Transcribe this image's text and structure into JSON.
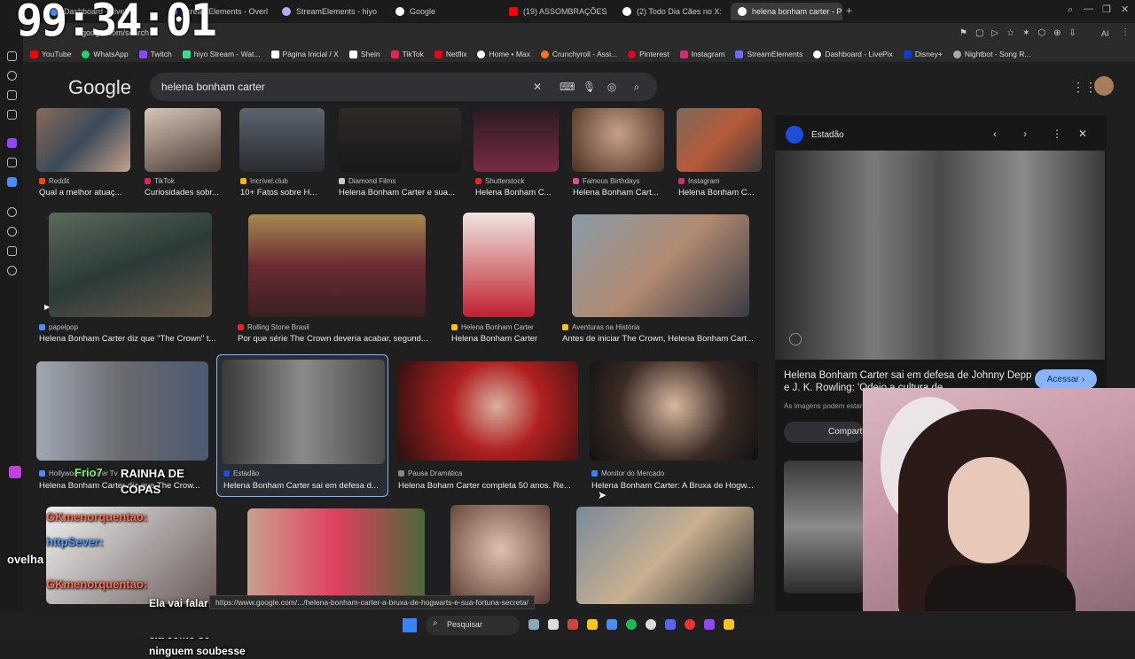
{
  "clock": "99:34:01",
  "tabs": [
    {
      "label": "Dashboard - LivePix",
      "color": "#4a8df8"
    },
    {
      "label": "StreamElements - Overlay",
      "color": "#6b6bff"
    },
    {
      "label": "StreamElements - hiyo",
      "color": "#b9a7ff"
    },
    {
      "label": "Google",
      "color": "#ffffff"
    },
    {
      "label": "(19) ASSOMBRAÇÕES INE",
      "color": "#ff0000"
    },
    {
      "label": "(2) Todo Dia Cães no X: \"",
      "color": "#ffffff"
    },
    {
      "label": "helena bonham carter - P",
      "color": "#ffffff"
    }
  ],
  "address": "google.com/search",
  "bookmarks": [
    {
      "label": "YouTube",
      "color": "#ff0000"
    },
    {
      "label": "WhatsApp",
      "color": "#25d366"
    },
    {
      "label": "Twitch",
      "color": "#9146ff"
    },
    {
      "label": "hiyo Stream - Wat...",
      "color": "#3ddc84"
    },
    {
      "label": "Página Inicial / X",
      "color": "#ffffff"
    },
    {
      "label": "Shein",
      "color": "#ffffff"
    },
    {
      "label": "TikTok",
      "color": "#ee1d52"
    },
    {
      "label": "Netflix",
      "color": "#e50914"
    },
    {
      "label": "Home • Max",
      "color": "#ffffff"
    },
    {
      "label": "Crunchyroll - Assi...",
      "color": "#f47521"
    },
    {
      "label": "Pinterest",
      "color": "#e60023"
    },
    {
      "label": "Instagram",
      "color": "#d62976"
    },
    {
      "label": "StreamElements",
      "color": "#6b6bff"
    },
    {
      "label": "Dashboard - LivePix",
      "color": "#ffffff"
    },
    {
      "label": "Disney+",
      "color": "#113ccf"
    },
    {
      "label": "Nightbot - Song R...",
      "color": "#aaaaaa"
    }
  ],
  "google": {
    "logo": "Google",
    "query": "helena bonham carter"
  },
  "results": [
    {
      "source": "Reddit",
      "title": "Qual a melhor atuaç...",
      "color": "#ff4500"
    },
    {
      "source": "TikTok",
      "title": "Curiosidades sobr...",
      "color": "#ee1d52"
    },
    {
      "source": "Incrível.club",
      "title": "10+ Fatos sobre H...",
      "color": "#ffb400"
    },
    {
      "source": "Diamond Films",
      "title": "Helena Bonham Carter e sua...",
      "color": "#cccccc"
    },
    {
      "source": "Shutterstock",
      "title": "Helena Bonham C...",
      "color": "#e22"
    },
    {
      "source": "Famous Birthdays",
      "title": "Helena Bonham Cart...",
      "color": "#e0489a"
    },
    {
      "source": "Instagram",
      "title": "Helena Bonham C...",
      "color": "#d62976"
    },
    {
      "source": "papelpop",
      "title": "Helena Bonham Carter diz que \"The Crown\" t...",
      "color": "#4a8df8"
    },
    {
      "source": "Rolling Stone Brasil",
      "title": "Por que série The Crown deveria acabar, segund...",
      "color": "#e22"
    },
    {
      "source": "Helena Bonham Carter",
      "title": "Helena Bonham Carter",
      "color": "#f5c518"
    },
    {
      "source": "Aventuras na História",
      "title": "Antes de iniciar The Crown, Helena Bonham Cart...",
      "color": "#f5c518"
    },
    {
      "source": "Hollywood Forever Tv",
      "title": "Helena Bonham Carter diz que The Crow...",
      "color": "#4a8df8"
    },
    {
      "source": "Estadão",
      "title": "Helena Bonham Carter sai em defesa d...",
      "color": "#1d4ed8"
    },
    {
      "source": "Pausa Dramática",
      "title": "Helena Boham Carter completa 50 anos. Re...",
      "color": "#888888"
    },
    {
      "source": "Monitor do Mercado",
      "title": "Helena Bonham Carter: A Bruxa de Hogw...",
      "color": "#3b82f6"
    }
  ],
  "panel": {
    "source": "Estadão",
    "title": "Helena Bonham Carter sai em defesa de Johnny Depp e J. K. Rowling: 'Odeio a cultura de...",
    "visit": "Acessar",
    "note": "As imagens podem estar sujeitas a direitos autorais",
    "share": "Compartilhar"
  },
  "chat": [
    {
      "user": "Frio7",
      "text": "RAINHA DE COPAS",
      "color": "#7cf07c"
    },
    {
      "user": "GKmenorquentao:",
      "text": "",
      "color": "#ff6a4d"
    },
    {
      "user": "httpSever:",
      "text": "ovelha",
      "color": "#4d9bff"
    },
    {
      "user": "GKmenorquentao:",
      "text": "Ela vai falar uma curiosidade que ela como se ninguem soubesse",
      "color": "#ff6a4d"
    }
  ],
  "status_url": "https://www.google.com/.../helena-bonham-carter-a-bruxa-de-hogwarts-e-sua-fortuna-secreta/",
  "taskbar": {
    "search": "Pesquisar"
  }
}
